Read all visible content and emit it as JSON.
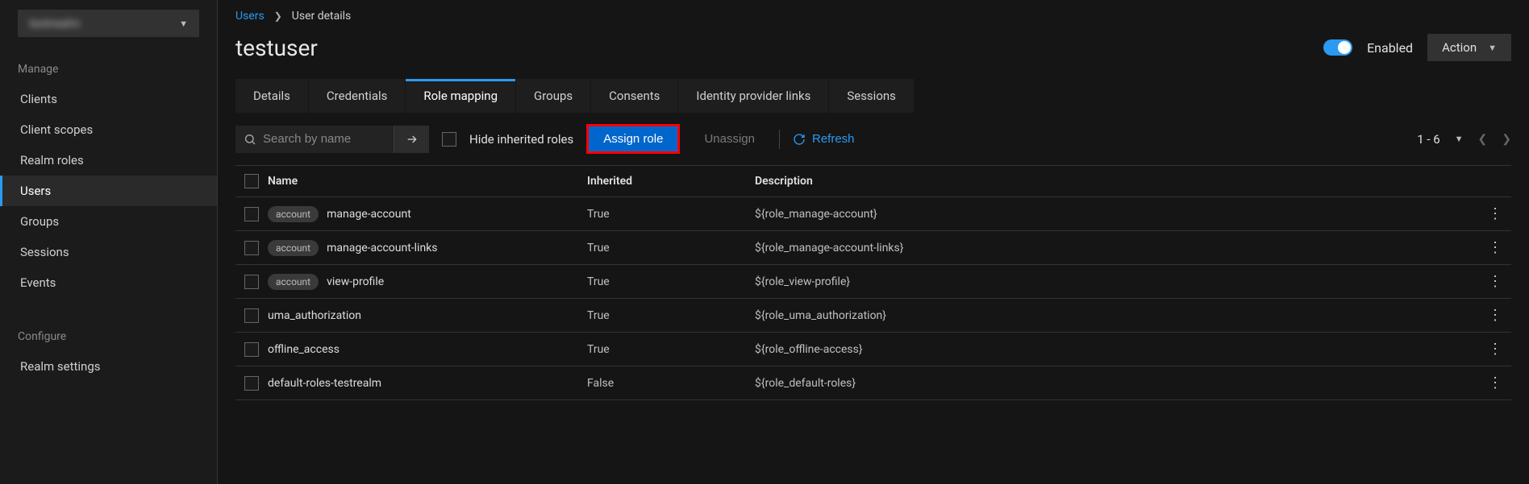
{
  "realm_selector_label": "testrealm",
  "sidebar": {
    "section_manage": "Manage",
    "section_configure": "Configure",
    "items_manage": [
      {
        "label": "Clients",
        "active": false
      },
      {
        "label": "Client scopes",
        "active": false
      },
      {
        "label": "Realm roles",
        "active": false
      },
      {
        "label": "Users",
        "active": true
      },
      {
        "label": "Groups",
        "active": false
      },
      {
        "label": "Sessions",
        "active": false
      },
      {
        "label": "Events",
        "active": false
      }
    ],
    "items_configure": [
      {
        "label": "Realm settings",
        "active": false
      }
    ]
  },
  "breadcrumb": {
    "root": "Users",
    "current": "User details"
  },
  "header": {
    "title": "testuser",
    "enabled_label": "Enabled",
    "action_label": "Action"
  },
  "tabs": [
    {
      "label": "Details",
      "active": false
    },
    {
      "label": "Credentials",
      "active": false
    },
    {
      "label": "Role mapping",
      "active": true
    },
    {
      "label": "Groups",
      "active": false
    },
    {
      "label": "Consents",
      "active": false
    },
    {
      "label": "Identity provider links",
      "active": false
    },
    {
      "label": "Sessions",
      "active": false
    }
  ],
  "toolbar": {
    "search_placeholder": "Search by name",
    "hide_inherited_label": "Hide inherited roles",
    "assign_label": "Assign role",
    "unassign_label": "Unassign",
    "refresh_label": "Refresh",
    "pagination_range": "1 - 6"
  },
  "table": {
    "headers": {
      "name": "Name",
      "inherited": "Inherited",
      "description": "Description"
    },
    "rows": [
      {
        "chip": "account",
        "name": "manage-account",
        "inherited": "True",
        "description": "${role_manage-account}"
      },
      {
        "chip": "account",
        "name": "manage-account-links",
        "inherited": "True",
        "description": "${role_manage-account-links}"
      },
      {
        "chip": "account",
        "name": "view-profile",
        "inherited": "True",
        "description": "${role_view-profile}"
      },
      {
        "chip": null,
        "name": "uma_authorization",
        "inherited": "True",
        "description": "${role_uma_authorization}"
      },
      {
        "chip": null,
        "name": "offline_access",
        "inherited": "True",
        "description": "${role_offline-access}"
      },
      {
        "chip": null,
        "name": "default-roles-testrealm",
        "inherited": "False",
        "description": "${role_default-roles}"
      }
    ]
  }
}
